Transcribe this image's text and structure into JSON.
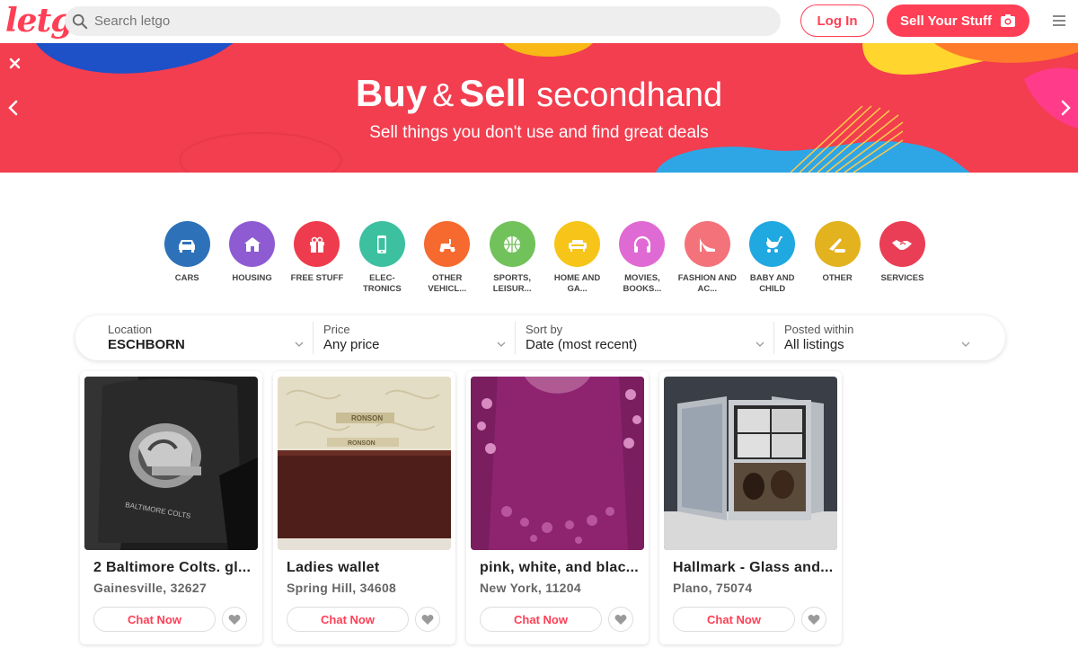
{
  "header": {
    "logo": "letgo",
    "search_placeholder": "Search letgo",
    "login_label": "Log In",
    "sell_label": "Sell Your Stuff"
  },
  "banner": {
    "title_buy": "Buy",
    "title_amp": "&",
    "title_sell": "Sell",
    "title_rest": "secondhand",
    "subtitle": "Sell things you don't use and find great deals"
  },
  "categories": [
    {
      "label": "CARS",
      "color": "#2d72b9",
      "icon": "car-icon"
    },
    {
      "label": "HOUSING",
      "color": "#8e5bd3",
      "icon": "house-icon"
    },
    {
      "label": "FREE STUFF",
      "color": "#ef3b4e",
      "icon": "gift-icon"
    },
    {
      "label": "ELEC-TRONICS",
      "color": "#3cc0a0",
      "icon": "phone-icon"
    },
    {
      "label": "OTHER VEHICL...",
      "color": "#f6692f",
      "icon": "scooter-icon"
    },
    {
      "label": "SPORTS, LEISUR...",
      "color": "#71c25a",
      "icon": "ball-icon"
    },
    {
      "label": "HOME AND GA...",
      "color": "#f7c51a",
      "icon": "sofa-icon"
    },
    {
      "label": "MOVIES, BOOKS...",
      "color": "#e06ad3",
      "icon": "headphones-icon"
    },
    {
      "label": "FASHION AND AC...",
      "color": "#f4737b",
      "icon": "heel-icon"
    },
    {
      "label": "BABY AND CHILD",
      "color": "#20a8e0",
      "icon": "stroller-icon"
    },
    {
      "label": "OTHER",
      "color": "#e3b21f",
      "icon": "knife-icon"
    },
    {
      "label": "SERVICES",
      "color": "#e93e55",
      "icon": "handshake-icon"
    }
  ],
  "filters": {
    "location": {
      "label": "Location",
      "value": "ESCHBORN"
    },
    "price": {
      "label": "Price",
      "value": "Any price"
    },
    "sort": {
      "label": "Sort by",
      "value": "Date (most recent)"
    },
    "posted": {
      "label": "Posted within",
      "value": "All listings"
    }
  },
  "listings": [
    {
      "title": "2 Baltimore Colts. gl...",
      "location": "Gainesville, 32627",
      "chat_label": "Chat Now"
    },
    {
      "title": "Ladies wallet",
      "location": "Spring Hill, 34608",
      "chat_label": "Chat Now"
    },
    {
      "title": "pink, white, and blac...",
      "location": "New York, 11204",
      "chat_label": "Chat Now"
    },
    {
      "title": "Hallmark - Glass and...",
      "location": "Plano, 75074",
      "chat_label": "Chat Now"
    }
  ],
  "colors": {
    "brand": "#ff3f55",
    "banner": "#f23e4f"
  }
}
